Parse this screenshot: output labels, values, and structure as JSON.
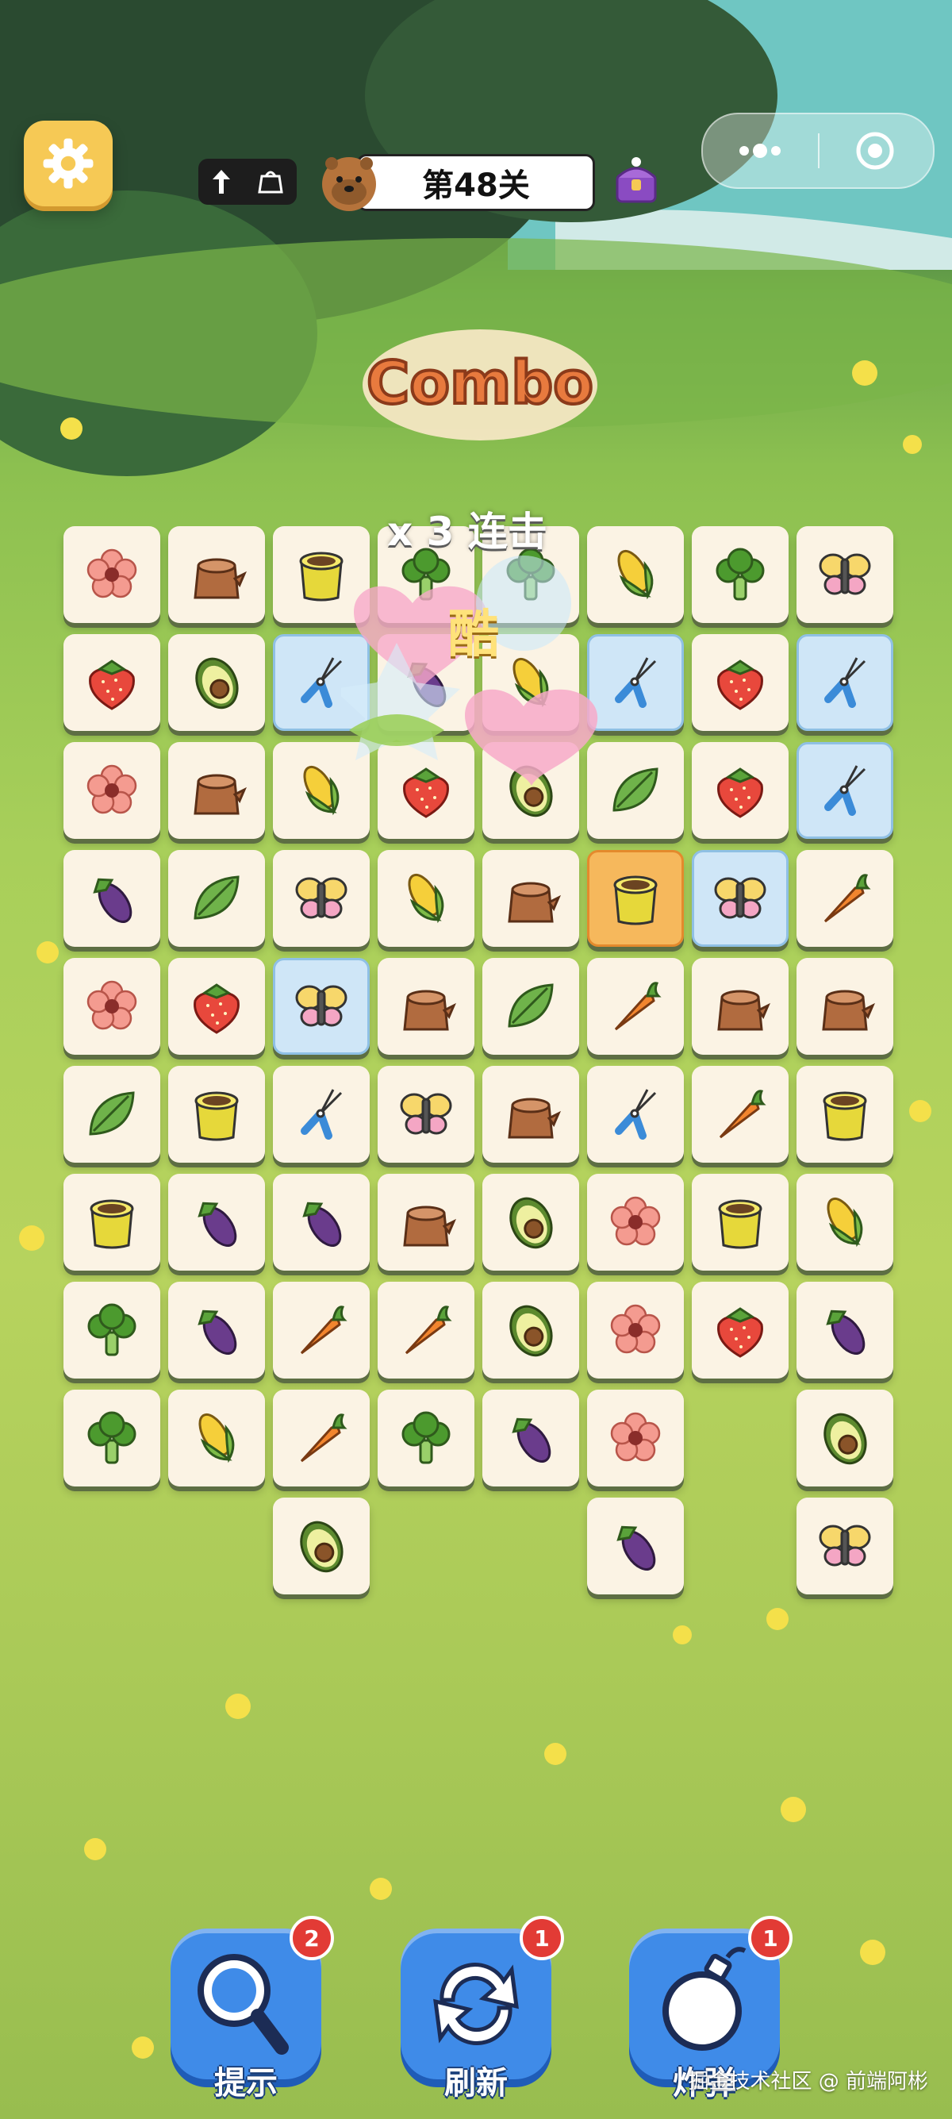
{
  "level": {
    "label": "第48关"
  },
  "combo": {
    "banner": "Combo",
    "count_text": "x 3 连击",
    "praise": "酷"
  },
  "colors": {
    "tile_bg": "#fbf3e4",
    "selected": "#cfe6f7",
    "active": "#f6b85c",
    "powerup": "#3f8be8",
    "badge": "#e23b35"
  },
  "board": {
    "columns": 8,
    "tiles": [
      {
        "r": 0,
        "c": 0,
        "icon": "flower"
      },
      {
        "r": 0,
        "c": 1,
        "icon": "stump"
      },
      {
        "r": 0,
        "c": 2,
        "icon": "pot"
      },
      {
        "r": 0,
        "c": 3,
        "icon": "broccoli"
      },
      {
        "r": 0,
        "c": 4,
        "icon": "broccoli"
      },
      {
        "r": 0,
        "c": 5,
        "icon": "corn"
      },
      {
        "r": 0,
        "c": 6,
        "icon": "broccoli"
      },
      {
        "r": 0,
        "c": 7,
        "icon": "butterfly"
      },
      {
        "r": 1,
        "c": 0,
        "icon": "strawberry"
      },
      {
        "r": 1,
        "c": 1,
        "icon": "avocado"
      },
      {
        "r": 1,
        "c": 2,
        "icon": "shears",
        "state": "selected"
      },
      {
        "r": 1,
        "c": 3,
        "icon": "eggplant"
      },
      {
        "r": 1,
        "c": 4,
        "icon": "corn"
      },
      {
        "r": 1,
        "c": 5,
        "icon": "shears",
        "state": "selected"
      },
      {
        "r": 1,
        "c": 6,
        "icon": "strawberry"
      },
      {
        "r": 1,
        "c": 7,
        "icon": "shears",
        "state": "selected"
      },
      {
        "r": 2,
        "c": 0,
        "icon": "flower"
      },
      {
        "r": 2,
        "c": 1,
        "icon": "stump"
      },
      {
        "r": 2,
        "c": 2,
        "icon": "corn"
      },
      {
        "r": 2,
        "c": 3,
        "icon": "strawberry"
      },
      {
        "r": 2,
        "c": 4,
        "icon": "avocado"
      },
      {
        "r": 2,
        "c": 5,
        "icon": "leaf"
      },
      {
        "r": 2,
        "c": 6,
        "icon": "strawberry"
      },
      {
        "r": 2,
        "c": 7,
        "icon": "shears",
        "state": "selected"
      },
      {
        "r": 3,
        "c": 0,
        "icon": "eggplant"
      },
      {
        "r": 3,
        "c": 1,
        "icon": "leaf"
      },
      {
        "r": 3,
        "c": 2,
        "icon": "butterfly"
      },
      {
        "r": 3,
        "c": 3,
        "icon": "corn"
      },
      {
        "r": 3,
        "c": 4,
        "icon": "stump"
      },
      {
        "r": 3,
        "c": 5,
        "icon": "pot",
        "state": "active"
      },
      {
        "r": 3,
        "c": 6,
        "icon": "butterfly",
        "state": "selected"
      },
      {
        "r": 3,
        "c": 7,
        "icon": "carrot"
      },
      {
        "r": 4,
        "c": 0,
        "icon": "flower"
      },
      {
        "r": 4,
        "c": 1,
        "icon": "strawberry"
      },
      {
        "r": 4,
        "c": 2,
        "icon": "butterfly",
        "state": "selected"
      },
      {
        "r": 4,
        "c": 3,
        "icon": "stump"
      },
      {
        "r": 4,
        "c": 4,
        "icon": "leaf"
      },
      {
        "r": 4,
        "c": 5,
        "icon": "carrot"
      },
      {
        "r": 4,
        "c": 6,
        "icon": "stump"
      },
      {
        "r": 4,
        "c": 7,
        "icon": "stump"
      },
      {
        "r": 5,
        "c": 0,
        "icon": "leaf"
      },
      {
        "r": 5,
        "c": 1,
        "icon": "pot"
      },
      {
        "r": 5,
        "c": 2,
        "icon": "shears"
      },
      {
        "r": 5,
        "c": 3,
        "icon": "butterfly"
      },
      {
        "r": 5,
        "c": 4,
        "icon": "stump"
      },
      {
        "r": 5,
        "c": 5,
        "icon": "shears"
      },
      {
        "r": 5,
        "c": 6,
        "icon": "carrot"
      },
      {
        "r": 5,
        "c": 7,
        "icon": "pot"
      },
      {
        "r": 6,
        "c": 0,
        "icon": "pot"
      },
      {
        "r": 6,
        "c": 1,
        "icon": "eggplant"
      },
      {
        "r": 6,
        "c": 2,
        "icon": "eggplant"
      },
      {
        "r": 6,
        "c": 3,
        "icon": "stump"
      },
      {
        "r": 6,
        "c": 4,
        "icon": "avocado"
      },
      {
        "r": 6,
        "c": 5,
        "icon": "flower"
      },
      {
        "r": 6,
        "c": 6,
        "icon": "pot"
      },
      {
        "r": 6,
        "c": 7,
        "icon": "corn"
      },
      {
        "r": 7,
        "c": 0,
        "icon": "broccoli"
      },
      {
        "r": 7,
        "c": 1,
        "icon": "eggplant"
      },
      {
        "r": 7,
        "c": 2,
        "icon": "carrot"
      },
      {
        "r": 7,
        "c": 3,
        "icon": "carrot"
      },
      {
        "r": 7,
        "c": 4,
        "icon": "avocado"
      },
      {
        "r": 7,
        "c": 5,
        "icon": "flower"
      },
      {
        "r": 7,
        "c": 6,
        "icon": "strawberry"
      },
      {
        "r": 7,
        "c": 7,
        "icon": "eggplant"
      },
      {
        "r": 8,
        "c": 0,
        "icon": "broccoli"
      },
      {
        "r": 8,
        "c": 1,
        "icon": "corn"
      },
      {
        "r": 8,
        "c": 2,
        "icon": "carrot"
      },
      {
        "r": 8,
        "c": 3,
        "icon": "broccoli"
      },
      {
        "r": 8,
        "c": 4,
        "icon": "eggplant"
      },
      {
        "r": 8,
        "c": 5,
        "icon": "flower"
      },
      {
        "r": 8,
        "c": 7,
        "icon": "avocado"
      },
      {
        "r": 9,
        "c": 2,
        "icon": "avocado"
      },
      {
        "r": 9,
        "c": 5,
        "icon": "eggplant"
      },
      {
        "r": 9,
        "c": 7,
        "icon": "butterfly"
      }
    ]
  },
  "powerups": [
    {
      "id": "hint",
      "label": "提示",
      "count": "2",
      "icon": "magnifier-icon"
    },
    {
      "id": "refresh",
      "label": "刷新",
      "count": "1",
      "icon": "refresh-icon"
    },
    {
      "id": "bomb",
      "label": "炸弹",
      "count": "1",
      "icon": "bomb-icon"
    }
  ],
  "watermark": "掘金技术社区 @ 前端阿彬"
}
